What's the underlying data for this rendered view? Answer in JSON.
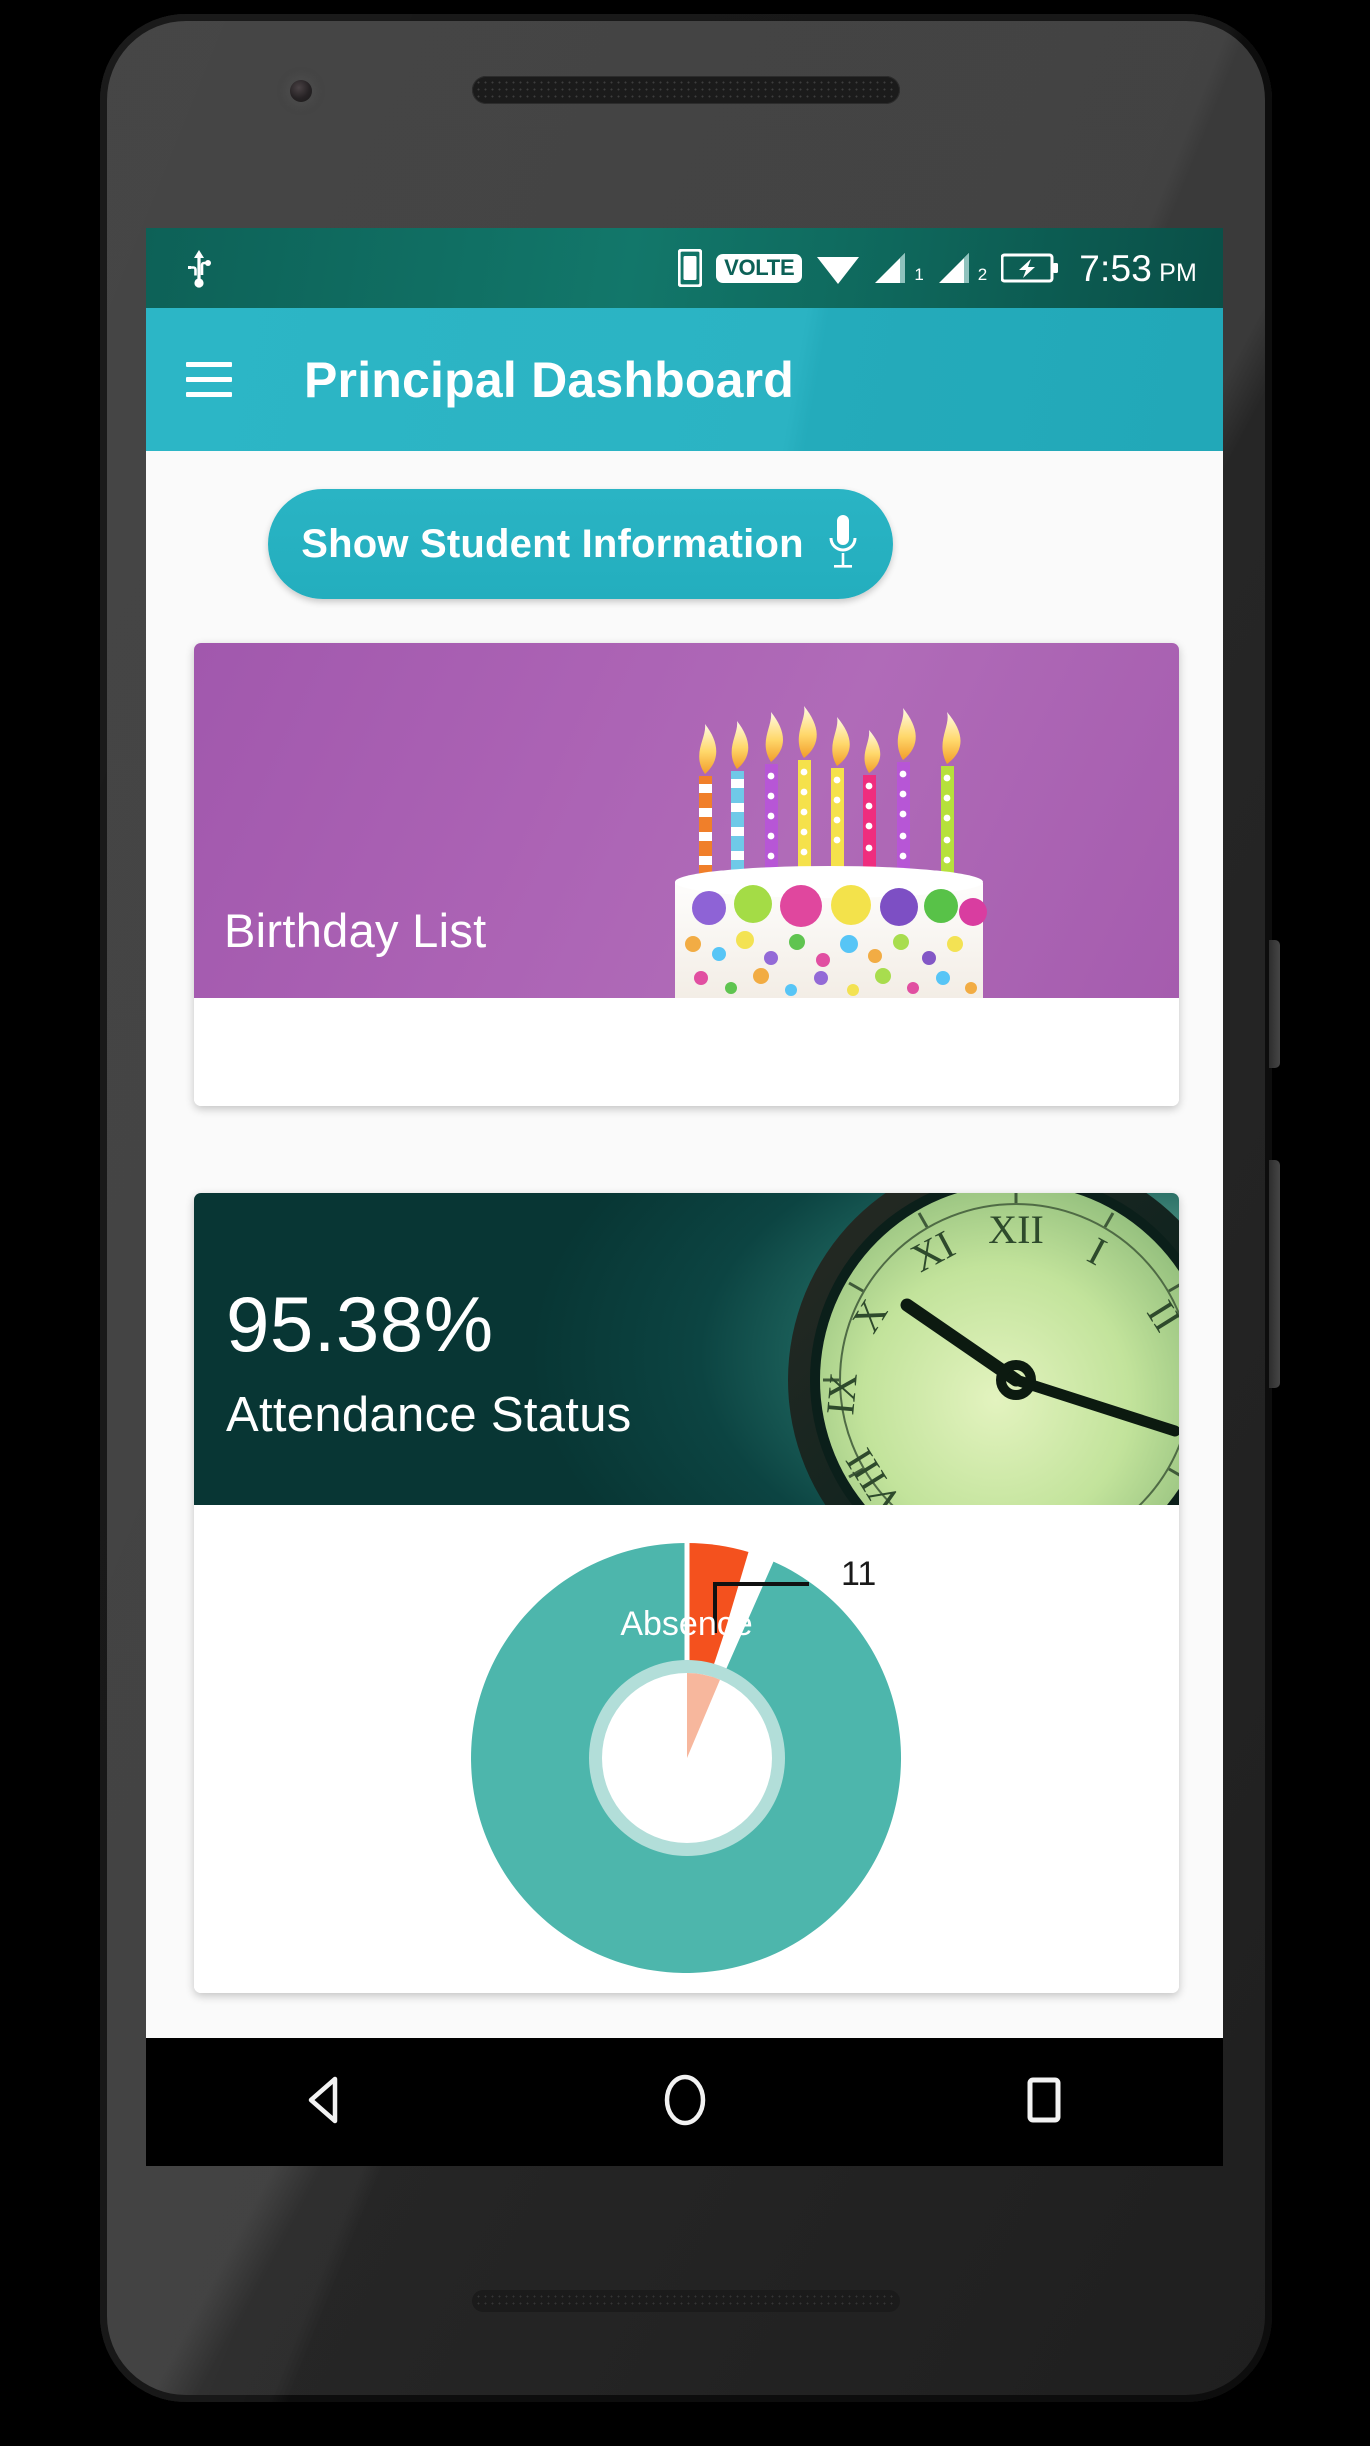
{
  "device": {
    "frame": "android-phone",
    "hardware": {
      "front_camera": "front-camera",
      "earpiece": "speaker-grille",
      "power_button": "power-button",
      "volume_button": "volume-button"
    }
  },
  "statusbar": {
    "usb_icon": "usb-icon",
    "sim_icon": "sim-card-icon",
    "volte_label": "VOLTE",
    "wifi_icon": "wifi-icon",
    "signal1_icon": "signal-bars-icon",
    "signal1_label": "1",
    "signal2_icon": "signal-bars-icon",
    "signal2_label": "2",
    "battery_icon": "battery-charging-icon",
    "time": "7:53",
    "ampm": "PM",
    "bg_color": "#0f6b5f"
  },
  "appbar": {
    "menu_icon": "hamburger-menu-icon",
    "title": "Principal Dashboard",
    "bg_color": "#2bb4c4"
  },
  "main": {
    "show_student_button": {
      "label": "Show Student Information",
      "icon": "microphone-icon",
      "bg_color": "#27b1c1"
    },
    "birthday_card": {
      "title": "Birthday List",
      "image": "birthday-cake-with-candles-photo",
      "bg_color": "#a85fb0"
    },
    "attendance_card": {
      "percentage": "95.38%",
      "label": "Attendance Status",
      "image": "analog-clock-photo",
      "bg_color": "#0d4b47"
    }
  },
  "chart_data": {
    "type": "pie",
    "variant": "donut",
    "title": "Attendance Status",
    "categories": [
      "Attendance",
      "Absence"
    ],
    "values": [
      227,
      11
    ],
    "labels_shown": [
      "Absence"
    ],
    "data_labels": [
      "11"
    ],
    "colors": [
      "#4db6ac",
      "#f4511e"
    ],
    "inner_radius_ratio": 0.45,
    "legend": "none",
    "grid": false,
    "annotations": [
      {
        "text": "11",
        "points_to": "Absence",
        "leader_line": true
      },
      {
        "text": "Absence",
        "position": "inside-slice"
      }
    ],
    "total_percent_label": "95.38%"
  },
  "navbar": {
    "back_icon": "back-triangle-icon",
    "home_icon": "home-circle-icon",
    "recents_icon": "recents-square-icon",
    "bg_color": "#000000"
  }
}
